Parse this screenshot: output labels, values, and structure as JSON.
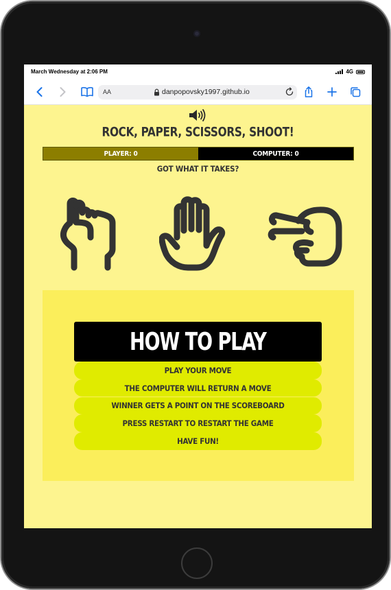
{
  "status_bar": {
    "time": "March Wednesday at 2:06 PM",
    "network": "4G"
  },
  "browser": {
    "reader_label": "AA",
    "url": "danpopovsky1997.github.io"
  },
  "game": {
    "title": "ROCK, PAPER, SCISSORS, SHOOT!",
    "player_score_label": "PLAYER: 0",
    "computer_score_label": "COMPUTER: 0",
    "tagline": "GOT WHAT IT TAKES?",
    "moves": [
      "rock-icon",
      "paper-icon",
      "scissors-icon"
    ]
  },
  "how_to_play": {
    "heading": "HOW TO PLAY",
    "steps": [
      "PLAY YOUR MOVE",
      "THE COMPUTER WILL RETURN A MOVE",
      "WINNER GETS A POINT ON THE SCOREBOARD",
      "PRESS RESTART TO RESTART THE GAME",
      "HAVE FUN!"
    ]
  },
  "colors": {
    "page_background": "#fdf48f",
    "panel_background": "#fbee5b",
    "step_background": "#e0eb00",
    "player_bar": "#8c7e00",
    "computer_bar": "#000000",
    "safari_blue": "#1a73e8"
  }
}
